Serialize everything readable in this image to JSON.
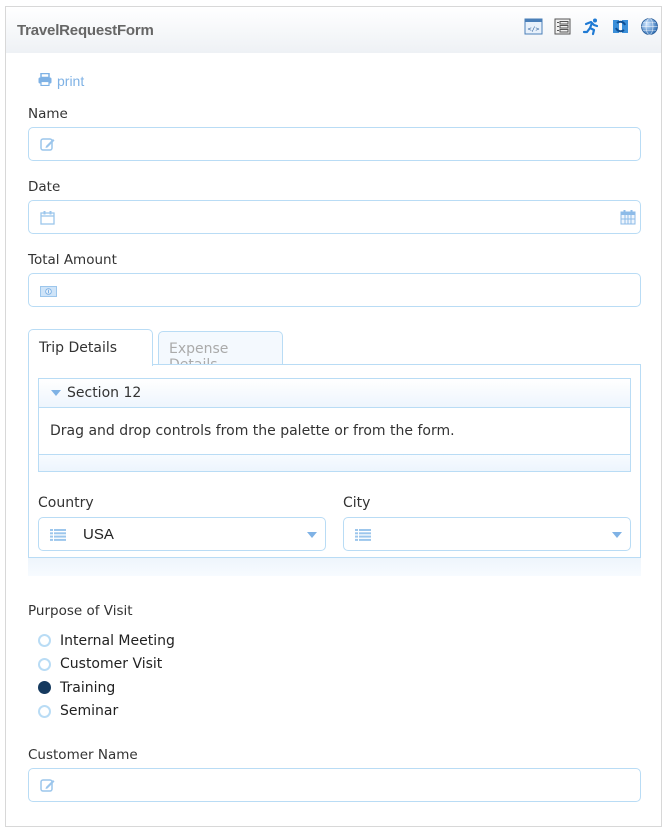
{
  "header": {
    "title": "TravelRequestForm",
    "icons": [
      "code-view-icon",
      "layout-icon",
      "run-icon",
      "sync-icon",
      "globe-icon"
    ]
  },
  "print": {
    "label": "print",
    "icon": "printer-icon"
  },
  "fields": {
    "name": {
      "label": "Name",
      "value": "",
      "icon": "edit-icon"
    },
    "date": {
      "label": "Date",
      "value": "",
      "icon": "calendar-icon"
    },
    "total_amount": {
      "label": "Total Amount",
      "value": "",
      "icon": "money-icon"
    },
    "customer_name": {
      "label": "Customer Name",
      "value": "",
      "icon": "edit-icon"
    }
  },
  "tabs": [
    {
      "label": "Trip Details",
      "active": true
    },
    {
      "label": "Expense Details",
      "active": false
    }
  ],
  "section": {
    "title": "Section 12",
    "placeholder": "Drag and drop controls from the palette or from the form."
  },
  "country": {
    "label": "Country",
    "value": "USA"
  },
  "city": {
    "label": "City",
    "value": ""
  },
  "purpose": {
    "label": "Purpose of Visit",
    "options": [
      {
        "label": "Internal Meeting",
        "checked": false
      },
      {
        "label": "Customer Visit",
        "checked": false
      },
      {
        "label": "Training",
        "checked": true
      },
      {
        "label": "Seminar",
        "checked": false
      }
    ]
  },
  "colors": {
    "accent": "#7fb2e5",
    "border": "#b9dcf5",
    "radio_checked": "#163a5f"
  }
}
